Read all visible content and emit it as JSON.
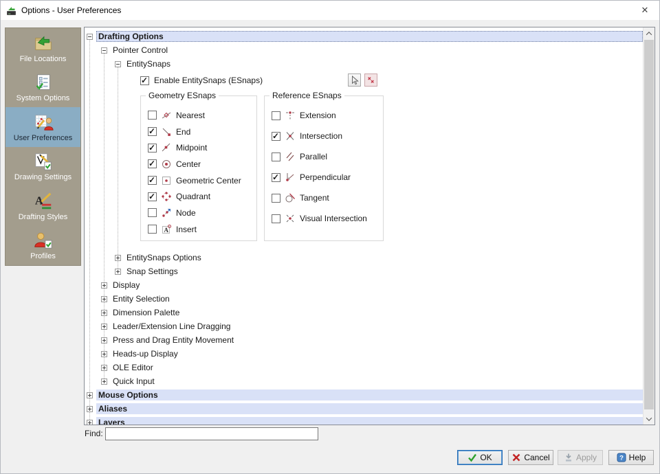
{
  "window": {
    "title": "Options - User Preferences",
    "close_glyph": "✕"
  },
  "sidebar": {
    "items": [
      {
        "label": "File Locations",
        "icon": "file-locations-icon",
        "selected": false
      },
      {
        "label": "System Options",
        "icon": "system-options-icon",
        "selected": false
      },
      {
        "label": "User Preferences",
        "icon": "user-preferences-icon",
        "selected": true
      },
      {
        "label": "Drawing Settings",
        "icon": "drawing-settings-icon",
        "selected": false
      },
      {
        "label": "Drafting Styles",
        "icon": "drafting-styles-icon",
        "selected": false
      },
      {
        "label": "Profiles",
        "icon": "profiles-icon",
        "selected": false
      }
    ]
  },
  "tree": {
    "rows": [
      {
        "label": "Drafting Options",
        "level": 0,
        "expanded": true,
        "bold": true,
        "highlighted": true
      },
      {
        "label": "Pointer Control",
        "level": 1,
        "expanded": true,
        "bold": false,
        "highlighted": false
      },
      {
        "label": "EntitySnaps",
        "level": 2,
        "expanded": true,
        "bold": false,
        "highlighted": false
      },
      {
        "label": "EntitySnaps Options",
        "level": 2,
        "expanded": false,
        "bold": false,
        "highlighted": false
      },
      {
        "label": "Snap Settings",
        "level": 2,
        "expanded": false,
        "bold": false,
        "highlighted": false
      },
      {
        "label": "Display",
        "level": 1,
        "expanded": false,
        "bold": false,
        "highlighted": false
      },
      {
        "label": "Entity Selection",
        "level": 1,
        "expanded": false,
        "bold": false,
        "highlighted": false
      },
      {
        "label": "Dimension Palette",
        "level": 1,
        "expanded": false,
        "bold": false,
        "highlighted": false
      },
      {
        "label": "Leader/Extension Line Dragging",
        "level": 1,
        "expanded": false,
        "bold": false,
        "highlighted": false
      },
      {
        "label": "Press and Drag Entity Movement",
        "level": 1,
        "expanded": false,
        "bold": false,
        "highlighted": false
      },
      {
        "label": "Heads-up Display",
        "level": 1,
        "expanded": false,
        "bold": false,
        "highlighted": false
      },
      {
        "label": "OLE Editor",
        "level": 1,
        "expanded": false,
        "bold": false,
        "highlighted": false
      },
      {
        "label": "Quick Input",
        "level": 1,
        "expanded": false,
        "bold": false,
        "highlighted": false
      },
      {
        "label": "Mouse Options",
        "level": 0,
        "expanded": false,
        "bold": true,
        "highlighted": true
      },
      {
        "label": "Aliases",
        "level": 0,
        "expanded": false,
        "bold": true,
        "highlighted": true
      },
      {
        "label": "Layers",
        "level": 0,
        "expanded": false,
        "bold": true,
        "highlighted": true
      }
    ]
  },
  "esnaps": {
    "enable": {
      "label": "Enable EntitySnaps (ESnaps)",
      "checked": true
    },
    "toolbar": {
      "select_button_icon": "select-esnaps-cursor-icon",
      "clear_button_icon": "clear-esnaps-icon"
    },
    "geometry": {
      "title": "Geometry ESnaps",
      "items": [
        {
          "label": "Nearest",
          "checked": false,
          "icon": "nearest-icon"
        },
        {
          "label": "End",
          "checked": true,
          "icon": "end-icon"
        },
        {
          "label": "Midpoint",
          "checked": true,
          "icon": "midpoint-icon"
        },
        {
          "label": "Center",
          "checked": true,
          "icon": "center-icon"
        },
        {
          "label": "Geometric Center",
          "checked": true,
          "icon": "geometric-center-icon"
        },
        {
          "label": "Quadrant",
          "checked": true,
          "icon": "quadrant-icon"
        },
        {
          "label": "Node",
          "checked": false,
          "icon": "node-icon"
        },
        {
          "label": "Insert",
          "checked": false,
          "icon": "insert-icon"
        }
      ]
    },
    "reference": {
      "title": "Reference ESnaps",
      "items": [
        {
          "label": "Extension",
          "checked": false,
          "icon": "extension-icon"
        },
        {
          "label": "Intersection",
          "checked": true,
          "icon": "intersection-icon"
        },
        {
          "label": "Parallel",
          "checked": false,
          "icon": "parallel-icon"
        },
        {
          "label": "Perpendicular",
          "checked": true,
          "icon": "perpendicular-icon"
        },
        {
          "label": "Tangent",
          "checked": false,
          "icon": "tangent-icon"
        },
        {
          "label": "Visual Intersection",
          "checked": false,
          "icon": "visual-intersection-icon"
        }
      ]
    }
  },
  "find": {
    "label": "Find:",
    "value": ""
  },
  "footer": {
    "buttons": [
      {
        "label": "OK",
        "icon": "check-icon",
        "enabled": true,
        "default": true
      },
      {
        "label": "Cancel",
        "icon": "x-icon",
        "enabled": true,
        "default": false
      },
      {
        "label": "Apply",
        "icon": "apply-icon",
        "enabled": false,
        "default": false
      },
      {
        "label": "Help",
        "icon": "help-icon",
        "enabled": true,
        "default": false
      }
    ]
  },
  "colors": {
    "sidebar_bg": "#a39d8d",
    "sidebar_selected_bg": "#8aadc4",
    "tree_row_highlight": "#d9e1f7",
    "esnap_accent_red": "#b03a48",
    "titlebar_bg": "#ffffff",
    "dialog_bg": "#f0f0f0"
  }
}
